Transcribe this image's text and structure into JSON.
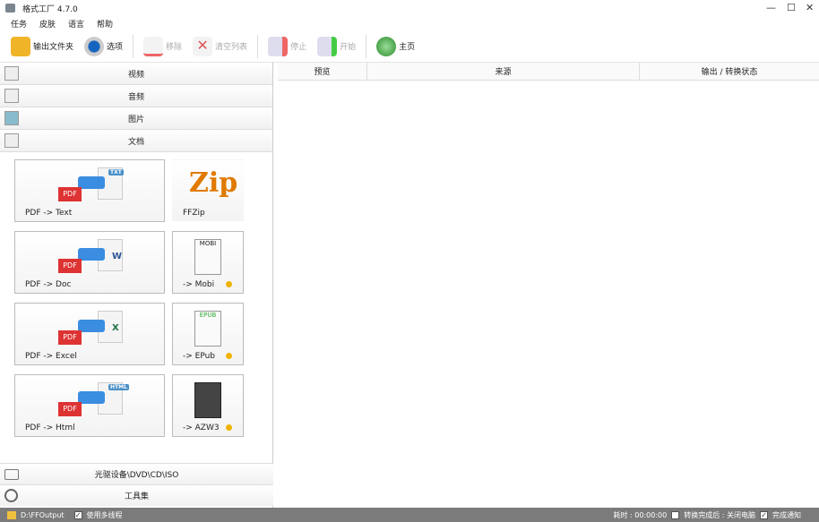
{
  "window": {
    "title": "格式工厂 4.7.0",
    "minimize": "—",
    "maximize": "☐",
    "close": "✕"
  },
  "menu": [
    "任务",
    "皮肤",
    "语言",
    "帮助"
  ],
  "toolbar": {
    "output_folder": "输出文件夹",
    "options": "选项",
    "remove": "移除",
    "clear_list": "清空列表",
    "stop": "停止",
    "start": "开始",
    "home": "主页"
  },
  "categories": [
    "视频",
    "音频",
    "图片",
    "文档"
  ],
  "tiles": [
    {
      "label": "PDF -> Text",
      "badge": "TXT"
    },
    {
      "label": "FFZip",
      "badge": "Zip"
    },
    {
      "label": "PDF -> Doc",
      "badge": "W"
    },
    {
      "label": "-> Mobi",
      "badge": "MOBI"
    },
    {
      "label": "PDF -> Excel",
      "badge": "X"
    },
    {
      "label": "-> EPub",
      "badge": "EPUB"
    },
    {
      "label": "PDF -> Html",
      "badge": "HTML"
    },
    {
      "label": "-> AZW3",
      "badge": ""
    }
  ],
  "pdf_badge": "PDF",
  "bottom_categories": [
    "光驱设备\\DVD\\CD\\ISO",
    "工具集"
  ],
  "table": {
    "columns": [
      "预览",
      "来源",
      "输出 / 转换状态"
    ]
  },
  "status": {
    "output_path": "D:\\FFOutput",
    "multithread": "使用多线程",
    "elapsed": "耗时 : 00:00:00",
    "after_convert": "转换完成后 : 关闭电脑",
    "notify": "完成通知",
    "check": "✓"
  }
}
